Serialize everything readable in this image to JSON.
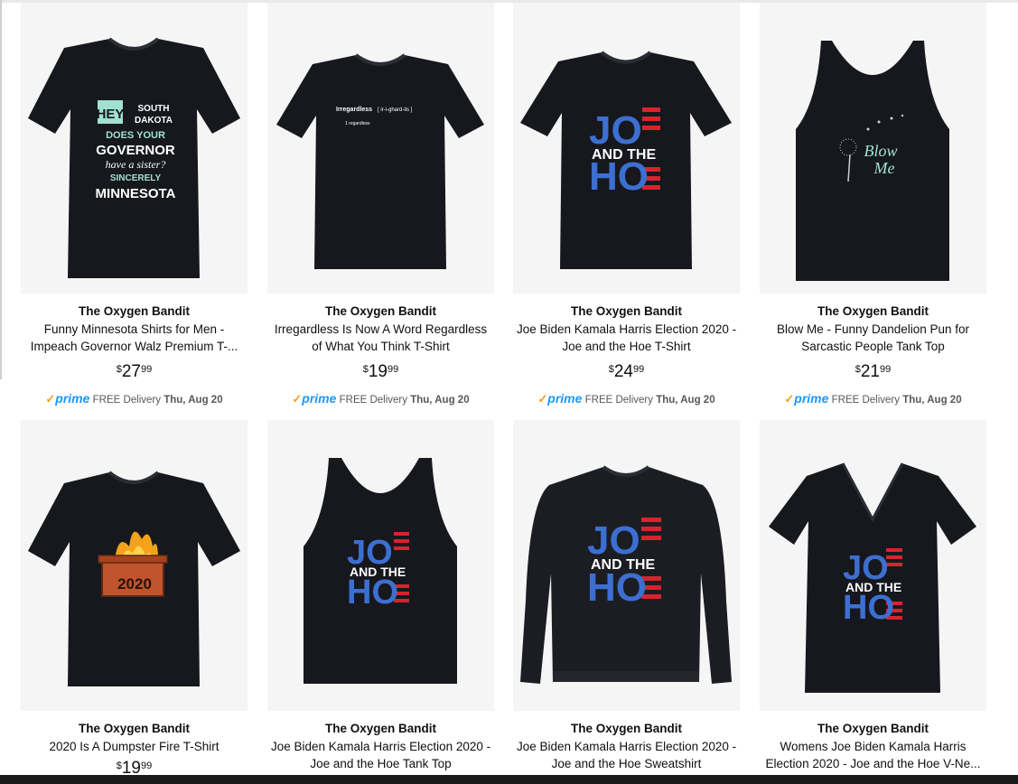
{
  "products": [
    {
      "brand": "The Oxygen Bandit",
      "title_line1": "Funny Minnesota Shirts for Men -",
      "title_line2": "Impeach Governor Walz Premium T-...",
      "price_symbol": "$",
      "price_whole": "27",
      "price_fraction": "99",
      "prime_label": "prime",
      "delivery_text": "FREE Delivery",
      "delivery_date": "Thu, Aug 20",
      "shirt_text": {
        "a": "HEY",
        "b": "SOUTH",
        "c": "DAKOTA",
        "d": "DOES YOUR",
        "e": "GOVERNOR",
        "f": "have a sister?",
        "g": "SINCERELY",
        "h": "MINNESOTA"
      }
    },
    {
      "brand": "The Oxygen Bandit",
      "title_line1": "Irregardless Is Now A Word Regardless",
      "title_line2": "of What You Think T-Shirt",
      "price_symbol": "$",
      "price_whole": "19",
      "price_fraction": "99",
      "prime_label": "prime",
      "delivery_text": "FREE Delivery",
      "delivery_date": "Thu, Aug 20",
      "shirt_text": {
        "a": "Irregardless",
        "b": "[ ir-i-ghard-lis ]",
        "c": "1 regardless"
      }
    },
    {
      "brand": "The Oxygen Bandit",
      "title_line1": "Joe Biden Kamala Harris Election 2020 -",
      "title_line2": "Joe and the Hoe T-Shirt",
      "price_symbol": "$",
      "price_whole": "24",
      "price_fraction": "99",
      "prime_label": "prime",
      "delivery_text": "FREE Delivery",
      "delivery_date": "Thu, Aug 20",
      "shirt_text": {
        "a": "JO",
        "b": "AND THE",
        "c": "HO"
      }
    },
    {
      "brand": "The Oxygen Bandit",
      "title_line1": "Blow Me - Funny Dandelion Pun for",
      "title_line2": "Sarcastic People Tank Top",
      "price_symbol": "$",
      "price_whole": "21",
      "price_fraction": "99",
      "prime_label": "prime",
      "delivery_text": "FREE Delivery",
      "delivery_date": "Thu, Aug 20",
      "shirt_text": {
        "a": "Blow",
        "b": "Me"
      }
    },
    {
      "brand": "The Oxygen Bandit",
      "title_line1": "2020 Is A Dumpster Fire T-Shirt",
      "title_line2": "",
      "price_symbol": "$",
      "price_whole": "19",
      "price_fraction": "99",
      "shirt_text": {
        "a": "2020"
      }
    },
    {
      "brand": "The Oxygen Bandit",
      "title_line1": "Joe Biden Kamala Harris Election 2020 -",
      "title_line2": "Joe and the Hoe Tank Top",
      "shirt_text": {
        "a": "JO",
        "b": "AND THE",
        "c": "HO"
      }
    },
    {
      "brand": "The Oxygen Bandit",
      "title_line1": "Joe Biden Kamala Harris Election 2020 -",
      "title_line2": "Joe and the Hoe Sweatshirt",
      "shirt_text": {
        "a": "JO",
        "b": "AND THE",
        "c": "HO"
      }
    },
    {
      "brand": "The Oxygen Bandit",
      "title_line1": "Womens Joe Biden Kamala Harris",
      "title_line2": "Election 2020 - Joe and the Hoe V-Ne...",
      "shirt_text": {
        "a": "JO",
        "b": "AND THE",
        "c": "HO"
      }
    }
  ],
  "colors": {
    "prime_blue": "#1a98ff",
    "prime_check": "#f29d1c",
    "shirt_black": "#16181d",
    "joe_blue": "#3d6fd1",
    "stripe_red": "#d8232f",
    "mint": "#9fe0d3"
  }
}
